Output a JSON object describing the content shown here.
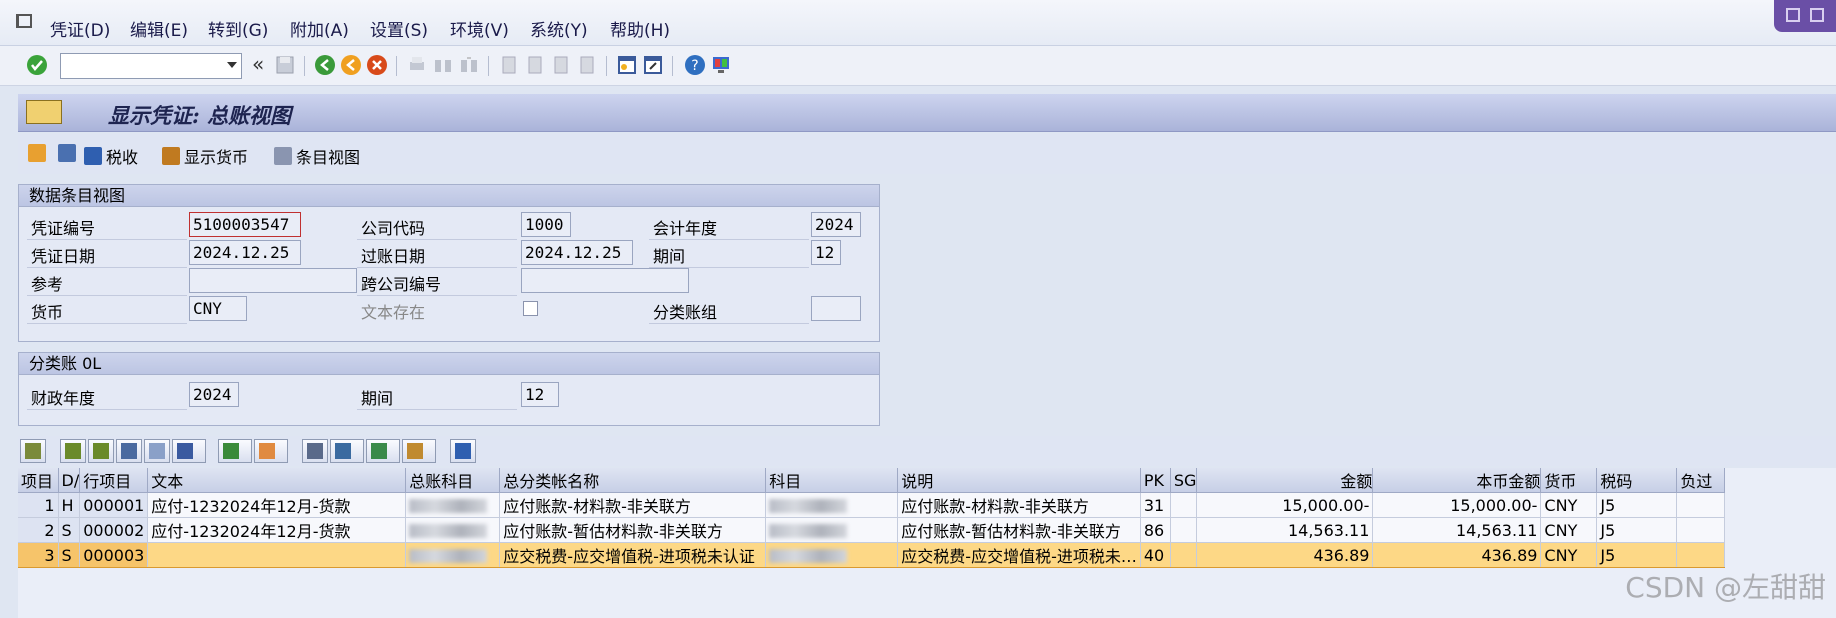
{
  "menu": [
    "凭证(D)",
    "编辑(E)",
    "转到(G)",
    "附加(A)",
    "设置(S)",
    "环境(V)",
    "系统(Y)",
    "帮助(H)"
  ],
  "title": "显示凭证: 总账视图",
  "app_toolbar": {
    "tax_label": "税收",
    "currency_label": "显示货币",
    "entry_view_label": "条目视图"
  },
  "data_entry_view": {
    "header": "数据条目视图",
    "doc_number_label": "凭证编号",
    "doc_number": "5100003547",
    "company_code_label": "公司代码",
    "company_code": "1000",
    "fiscal_year_label": "会计年度",
    "fiscal_year": "2024",
    "doc_date_label": "凭证日期",
    "doc_date": "2024.12.25",
    "posting_date_label": "过账日期",
    "posting_date": "2024.12.25",
    "period_label": "期间",
    "period": "12",
    "reference_label": "参考",
    "reference": "",
    "cross_company_label": "跨公司编号",
    "cross_company": "",
    "currency_label": "货币",
    "currency": "CNY",
    "text_exists_label": "文本存在",
    "ledger_group_label": "分类账组",
    "ledger_group": ""
  },
  "ledger": {
    "header": "分类账 0L",
    "fiscal_year_label": "财政年度",
    "fiscal_year": "2024",
    "period_label": "期间",
    "period": "12"
  },
  "grid": {
    "columns": [
      "项目",
      "D/",
      "行项目",
      "文本",
      "总账科目",
      "总分类帐名称",
      "科目",
      "说明",
      "PK",
      "SG",
      "金额",
      "本币金额",
      "货币",
      "税码",
      "负过"
    ],
    "rows": [
      {
        "item": "1",
        "dc": "H",
        "line": "000001",
        "text": "应付-1232024年12月-货款",
        "gl_name": "应付账款-材料款-非关联方",
        "desc": "应付账款-材料款-非关联方",
        "pk": "31",
        "sg": "",
        "amount": "15,000.00-",
        "local_amount": "15,000.00-",
        "currency": "CNY",
        "tax": "J5"
      },
      {
        "item": "2",
        "dc": "S",
        "line": "000002",
        "text": "应付-1232024年12月-货款",
        "gl_name": "应付账款-暂估材料款-非关联方",
        "desc": "应付账款-暂估材料款-非关联方",
        "pk": "86",
        "sg": "",
        "amount": "14,563.11",
        "local_amount": "14,563.11",
        "currency": "CNY",
        "tax": "J5"
      },
      {
        "item": "3",
        "dc": "S",
        "line": "000003",
        "text": "",
        "gl_name": "应交税费-应交增值税-进项税未认证",
        "desc": "应交税费-应交增值税-进项税未…",
        "pk": "40",
        "sg": "",
        "amount": "436.89",
        "local_amount": "436.89",
        "currency": "CNY",
        "tax": "J5"
      }
    ]
  },
  "watermark": "CSDN @左甜甜",
  "colors": {
    "selected_row": "#fdd886",
    "title_bar": "#aab3d9",
    "background": "#dfe6f2"
  }
}
